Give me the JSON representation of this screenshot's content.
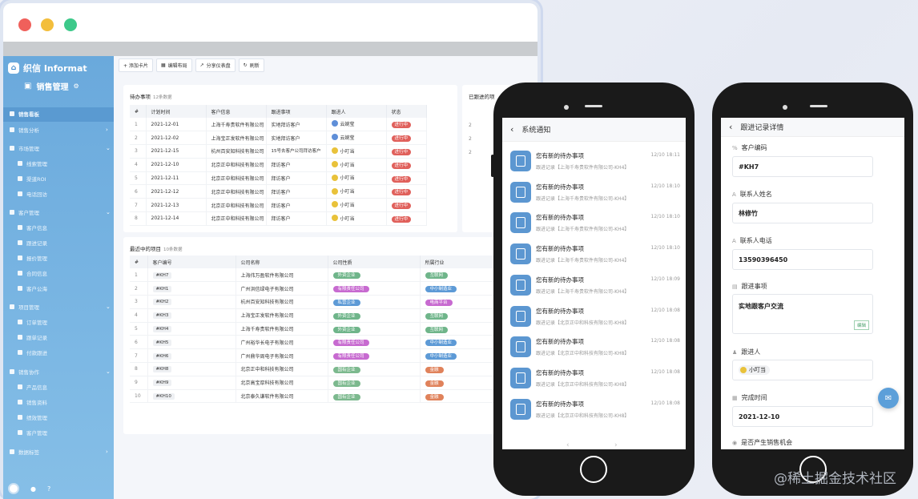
{
  "sidebar": {
    "brand": "织信 Informat",
    "project": "销售管理",
    "items": [
      {
        "label": "销售看板",
        "sub": false,
        "active": true
      },
      {
        "label": "销售分析",
        "sub": false,
        "chev": ">"
      },
      {
        "label": "市场管理",
        "sub": false,
        "chev": "v"
      },
      {
        "label": "线索管理",
        "sub": true
      },
      {
        "label": "渠道ROI",
        "sub": true
      },
      {
        "label": "电话回访",
        "sub": true
      },
      {
        "label": "客户管理",
        "sub": false,
        "chev": "v"
      },
      {
        "label": "客户信息",
        "sub": true
      },
      {
        "label": "跟进记录",
        "sub": true
      },
      {
        "label": "报价管理",
        "sub": true
      },
      {
        "label": "合同信息",
        "sub": true
      },
      {
        "label": "客户公海",
        "sub": true
      },
      {
        "label": "项目管理",
        "sub": false,
        "chev": "v"
      },
      {
        "label": "订单管理",
        "sub": true
      },
      {
        "label": "跟单记录",
        "sub": true
      },
      {
        "label": "付款跟进",
        "sub": true
      },
      {
        "label": "销售协作",
        "sub": false,
        "chev": "v"
      },
      {
        "label": "产品信息",
        "sub": true
      },
      {
        "label": "销售资料",
        "sub": true
      },
      {
        "label": "绩效管理",
        "sub": true
      },
      {
        "label": "客户管理",
        "sub": true
      },
      {
        "label": "数据标签",
        "sub": false,
        "chev": ">"
      }
    ]
  },
  "toolbar": {
    "add_card": "+ 添加卡片",
    "edit_layout": "编辑布局",
    "share": "分享仪表盘",
    "refresh": "刷新"
  },
  "todo": {
    "title": "待办事项",
    "count": "12条数据",
    "columns": [
      "#",
      "计划时间",
      "客户信息",
      "跟进事项",
      "跟进人",
      "状态"
    ],
    "rows": [
      [
        "1",
        "2021-12-01",
        "上海千寿贵软件有限公司",
        "实地拜访客户",
        "云婉莹",
        "进行中"
      ],
      [
        "2",
        "2021-12-02",
        "上海宝正发软件有限公司",
        "实地拜访客户",
        "云婉莹",
        "进行中"
      ],
      [
        "3",
        "2021-12-15",
        "杭州百安知科技有限公司",
        "15号去客户公司拜访客户",
        "小叮当",
        "进行中"
      ],
      [
        "4",
        "2021-12-10",
        "北京正中和科技有限公司",
        "拜访客户",
        "小叮当",
        "进行中"
      ],
      [
        "5",
        "2021-12-11",
        "北京正中和科技有限公司",
        "拜访客户",
        "小叮当",
        "进行中"
      ],
      [
        "6",
        "2021-12-12",
        "北京正中和科技有限公司",
        "拜访客户",
        "小叮当",
        "进行中"
      ],
      [
        "7",
        "2021-12-13",
        "北京正中和科技有限公司",
        "拜访客户",
        "小叮当",
        "进行中"
      ],
      [
        "8",
        "2021-12-14",
        "北京正中和科技有限公司",
        "拜访客户",
        "小叮当",
        "进行中"
      ]
    ]
  },
  "followed": {
    "title": "已跟进的项",
    "rows": [
      "2",
      "2",
      "2"
    ]
  },
  "recent": {
    "title": "最近中的项目",
    "count": "10条数据",
    "columns": [
      "#",
      "客户编号",
      "公司名称",
      "公司性质",
      "所属行业"
    ],
    "rows": [
      [
        "1",
        "#KH7",
        "上海伟万盈软件有限公司",
        "外资企业",
        "互联网"
      ],
      [
        "2",
        "#KH1",
        "广州洪信绿电子有限公司",
        "有限责任公司",
        "中小制造业"
      ],
      [
        "3",
        "#KH2",
        "杭州百安知科技有限公司",
        "私营企业",
        "电商平台"
      ],
      [
        "4",
        "#KH3",
        "上海宝正发软件有限公司",
        "外资企业",
        "互联网"
      ],
      [
        "5",
        "#KH4",
        "上海千寿贵软件有限公司",
        "外资企业",
        "互联网"
      ],
      [
        "6",
        "#KH5",
        "广州裕华长电子有限公司",
        "有限责任公司",
        "中小制造业"
      ],
      [
        "7",
        "#KH6",
        "广州鼎华周电子有限公司",
        "有限责任公司",
        "中小制造业"
      ],
      [
        "8",
        "#KH8",
        "北京正中和科技有限公司",
        "国有企业",
        "金融"
      ],
      [
        "9",
        "#KH9",
        "北京高宝厚科技有限公司",
        "国有企业",
        "金融"
      ],
      [
        "10",
        "#KH10",
        "北京泰久谦软件有限公司",
        "国有企业",
        "金融"
      ]
    ]
  },
  "phone1": {
    "title": "系统通知",
    "notifications": [
      {
        "title": "您有新的待办事项",
        "sub": "跟进记录【上海千寿贵软件有限公司-KH4】",
        "time": "12/10 18:11"
      },
      {
        "title": "您有新的待办事项",
        "sub": "跟进记录【上海千寿贵软件有限公司-KH4】",
        "time": "12/10 18:10"
      },
      {
        "title": "您有新的待办事项",
        "sub": "跟进记录【上海千寿贵软件有限公司-KH4】",
        "time": "12/10 18:10"
      },
      {
        "title": "您有新的待办事项",
        "sub": "跟进记录【上海千寿贵软件有限公司-KH4】",
        "time": "12/10 18:10"
      },
      {
        "title": "您有新的待办事项",
        "sub": "跟进记录【上海千寿贵软件有限公司-KH4】",
        "time": "12/10 18:09"
      },
      {
        "title": "您有新的待办事项",
        "sub": "跟进记录【北京正中和科技有限公司-KH8】",
        "time": "12/10 18:08"
      },
      {
        "title": "您有新的待办事项",
        "sub": "跟进记录【北京正中和科技有限公司-KH8】",
        "time": "12/10 18:08"
      },
      {
        "title": "您有新的待办事项",
        "sub": "跟进记录【北京正中和科技有限公司-KH8】",
        "time": "12/10 18:08"
      },
      {
        "title": "您有新的待办事项",
        "sub": "跟进记录【北京正中和科技有限公司-KH8】",
        "time": "12/10 18:08"
      }
    ]
  },
  "phone2": {
    "title": "跟进记录详情",
    "fields": {
      "code_label": "客户编码",
      "code": "#KH7",
      "name_label": "联系人姓名",
      "name": "林修竹",
      "phone_label": "联系人电话",
      "phone": "13590396450",
      "item_label": "跟进事项",
      "item": "实地跟客户交流",
      "edit": "编辑",
      "person_label": "跟进人",
      "person": "小叮当",
      "done_label": "完成时间",
      "done": "2021-12-10",
      "chance_label": "是否产生销售机会"
    }
  },
  "watermark": "@稀土掘金技术社区",
  "colors": {
    "accent": "#5c97d1",
    "status": "#e0605b",
    "tag_blue": "#5d9ad6",
    "tag_purple": "#c76ad0",
    "tag_green": "#6fb58a",
    "tag_orange": "#e0825b"
  }
}
